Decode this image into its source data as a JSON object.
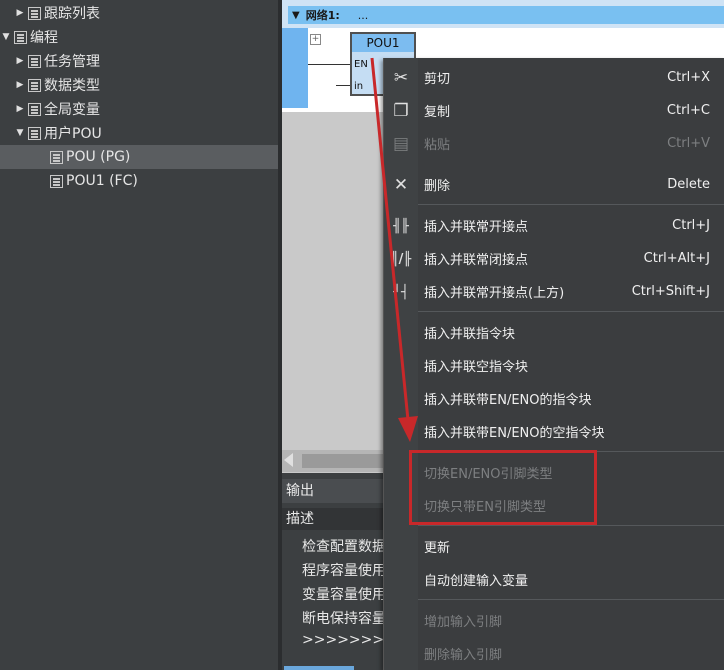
{
  "tree": {
    "items": [
      {
        "label": "跟踪列表",
        "expanded": false
      },
      {
        "label": "编程",
        "expanded": true
      },
      {
        "label": "任务管理",
        "expanded": false
      },
      {
        "label": "数据类型",
        "expanded": false
      },
      {
        "label": "全局变量",
        "expanded": false
      },
      {
        "label": "用户POU",
        "expanded": true
      },
      {
        "label": "POU (PG)",
        "selected": true
      },
      {
        "label": "POU1 (FC)",
        "selected": false
      }
    ]
  },
  "editor": {
    "network_label": "网络1:",
    "network_comment": "...",
    "pou_block": {
      "title": "POU1",
      "pin_en": "EN",
      "pin_in": "in"
    }
  },
  "output": {
    "title": "输出",
    "description_header": "描述",
    "lines": [
      "检查配置数据",
      "程序容量使用",
      "变量容量使用",
      "断电保持容量",
      ">>>>>>>>"
    ]
  },
  "context_menu": {
    "items": [
      {
        "icon": "scissors-icon",
        "label": "剪切",
        "shortcut": "Ctrl+X",
        "enabled": true
      },
      {
        "icon": "copy-icon",
        "label": "复制",
        "shortcut": "Ctrl+C",
        "enabled": true
      },
      {
        "icon": "paste-icon",
        "label": "粘贴",
        "shortcut": "Ctrl+V",
        "enabled": false
      },
      {
        "icon": "delete-x-icon",
        "label": "删除",
        "shortcut": "Delete",
        "enabled": true
      },
      {
        "icon": "parallel-no-contact-icon",
        "label": "插入并联常开接点",
        "shortcut": "Ctrl+J",
        "enabled": true
      },
      {
        "icon": "parallel-nc-contact-icon",
        "label": "插入并联常闭接点",
        "shortcut": "Ctrl+Alt+J",
        "enabled": true
      },
      {
        "icon": "parallel-no-contact-above-icon",
        "label": "插入并联常开接点(上方)",
        "shortcut": "Ctrl+Shift+J",
        "enabled": true
      },
      {
        "label": "插入并联指令块",
        "shortcut": "",
        "enabled": true
      },
      {
        "label": "插入并联空指令块",
        "shortcut": "",
        "enabled": true
      },
      {
        "label": "插入并联带EN/ENO的指令块",
        "shortcut": "",
        "enabled": true
      },
      {
        "label": "插入并联带EN/ENO的空指令块",
        "shortcut": "",
        "enabled": true
      },
      {
        "label": "切换EN/ENO引脚类型",
        "shortcut": "",
        "enabled": false
      },
      {
        "label": "切换只带EN引脚类型",
        "shortcut": "",
        "enabled": false
      },
      {
        "label": "更新",
        "shortcut": "",
        "enabled": true
      },
      {
        "label": "自动创建输入变量",
        "shortcut": "",
        "enabled": true
      },
      {
        "label": "增加输入引脚",
        "shortcut": "",
        "enabled": false
      },
      {
        "label": "删除输入引脚",
        "shortcut": "",
        "enabled": false
      }
    ]
  },
  "colors": {
    "annotation_red": "#c8282a",
    "network_bar": "#79c0f1",
    "menu_background": "#3b3d3f"
  }
}
